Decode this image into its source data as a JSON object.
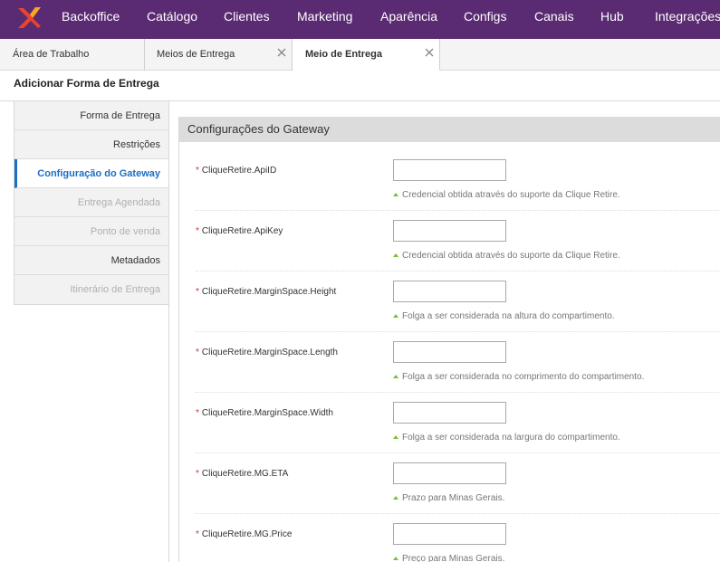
{
  "topnav": {
    "items": [
      "Backoffice",
      "Catálogo",
      "Clientes",
      "Marketing",
      "Aparência",
      "Configs",
      "Canais",
      "Hub",
      "Integrações"
    ],
    "colors": {
      "background": "#5a2b72",
      "logo_primary": "#e8452a",
      "logo_secondary": "#f5a623"
    }
  },
  "tabs": [
    {
      "label": "Área de Trabalho",
      "closable": false,
      "active": false
    },
    {
      "label": "Meios de Entrega",
      "closable": true,
      "active": false
    },
    {
      "label": "Meio de Entrega",
      "closable": true,
      "active": true
    }
  ],
  "page": {
    "title": "Adicionar Forma de Entrega"
  },
  "sidemenu": {
    "items": [
      {
        "label": "Forma de Entrega",
        "state": "normal"
      },
      {
        "label": "Restrições",
        "state": "normal"
      },
      {
        "label": "Configuração do Gateway",
        "state": "active"
      },
      {
        "label": "Entrega Agendada",
        "state": "disabled"
      },
      {
        "label": "Ponto de venda",
        "state": "disabled"
      },
      {
        "label": "Metadados",
        "state": "normal"
      },
      {
        "label": "Itinerário de Entrega",
        "state": "disabled"
      }
    ],
    "active_color": "#1b6ec2"
  },
  "panel": {
    "title": "Configurações do Gateway",
    "fields": [
      {
        "label": "CliqueRetire.ApiID",
        "value": "",
        "hint": "Credencial obtida através do suporte da Clique Retire."
      },
      {
        "label": "CliqueRetire.ApiKey",
        "value": "",
        "hint": "Credencial obtida através do suporte da Clique Retire."
      },
      {
        "label": "CliqueRetire.MarginSpace.Height",
        "value": "",
        "hint": "Folga a ser considerada na altura do compartimento."
      },
      {
        "label": "CliqueRetire.MarginSpace.Length",
        "value": "",
        "hint": "Folga a ser considerada no comprimento do compartimento."
      },
      {
        "label": "CliqueRetire.MarginSpace.Width",
        "value": "",
        "hint": "Folga a ser considerada na largura do compartimento."
      },
      {
        "label": "CliqueRetire.MG.ETA",
        "value": "",
        "hint": "Prazo para Minas Gerais."
      },
      {
        "label": "CliqueRetire.MG.Price",
        "value": "",
        "hint": "Preço para Minas Gerais."
      }
    ],
    "required_marker": "*",
    "hint_arrow_color": "#7cbf2f"
  }
}
